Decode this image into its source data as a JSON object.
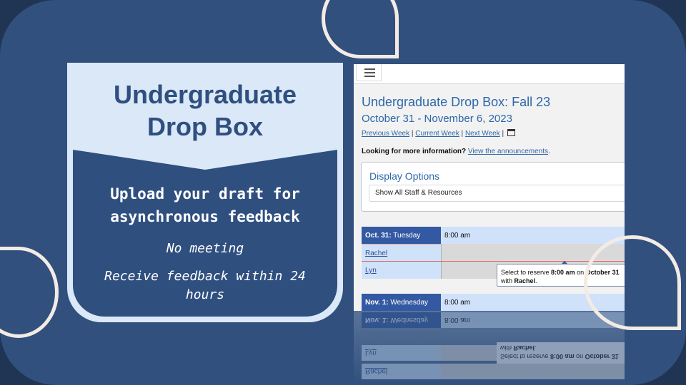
{
  "card": {
    "title_line1": "Undergraduate",
    "title_line2": "Drop Box",
    "upload_line1": "Upload your draft for",
    "upload_line2": "asynchronous feedback",
    "no_meeting": "No meeting",
    "receive": "Receive feedback within 24 hours"
  },
  "screenshot": {
    "menu_icon": "hamburger-icon",
    "title": "Undergraduate Drop Box: Fall 23",
    "date_range": "October 31 - November 6, 2023",
    "nav": {
      "previous": "Previous Week",
      "current": "Current Week",
      "next": "Next Week",
      "separator": "|",
      "calendar_icon": "calendar-icon"
    },
    "info": {
      "prefix": "Looking for more information?",
      "link": "View the announcements",
      "suffix": "."
    },
    "display_options": {
      "title": "Display Options",
      "selected": "Show All Staff & Resources"
    },
    "days": [
      {
        "date": "Oct. 31:",
        "weekday": "Tuesday",
        "time": "8:00 am",
        "staff": [
          "Rachel",
          "Lyn"
        ]
      },
      {
        "date": "Nov. 1:",
        "weekday": "Wednesday",
        "time": "8:00 am"
      }
    ],
    "tooltip": {
      "prefix": "Select to reserve",
      "time": "8:00 am",
      "on": "on",
      "date": "October 31",
      "with": "with",
      "name": "Rachel",
      "end": "."
    }
  },
  "colors": {
    "background": "#31507d",
    "card_light": "#dbe8f7",
    "card_dark": "#2f4f7f",
    "accent_link": "#2e67a8",
    "day_header": "#3459a3",
    "decor_outline": "#f3ebe4"
  }
}
